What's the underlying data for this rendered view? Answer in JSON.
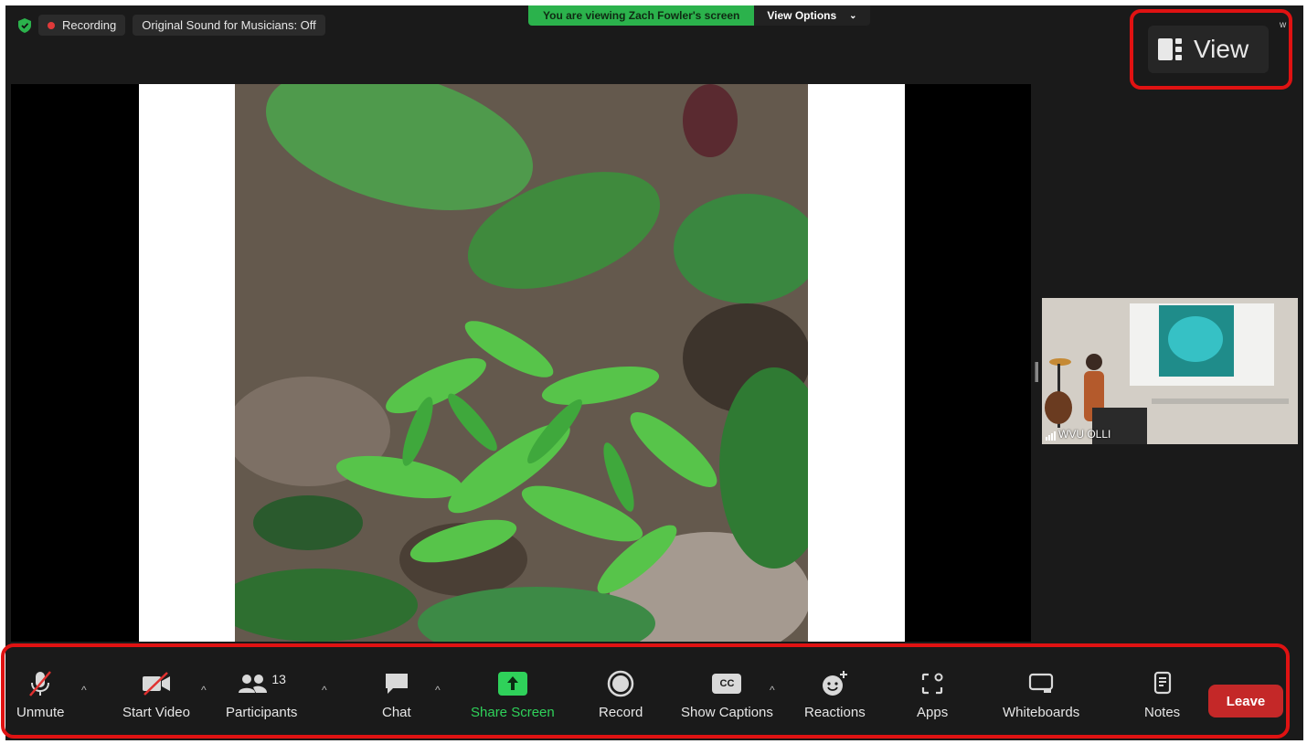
{
  "topbar": {
    "recording_label": "Recording",
    "original_sound_label": "Original Sound for Musicians: Off",
    "banner_text": "You are viewing Zach Fowler's screen",
    "view_options_label": "View Options",
    "view_label": "View",
    "corner_letter": "w"
  },
  "participant_tile": {
    "name": "WVU OLLI"
  },
  "toolbar": {
    "unmute": "Unmute",
    "start_video": "Start Video",
    "participants": "Participants",
    "participants_count": "13",
    "chat": "Chat",
    "share_screen": "Share Screen",
    "record": "Record",
    "show_captions": "Show Captions",
    "cc": "CC",
    "reactions": "Reactions",
    "apps": "Apps",
    "whiteboards": "Whiteboards",
    "notes": "Notes",
    "leave": "Leave"
  },
  "colors": {
    "accent_green": "#2bb24c",
    "leave_red": "#c42828",
    "highlight_red": "#e01212"
  }
}
